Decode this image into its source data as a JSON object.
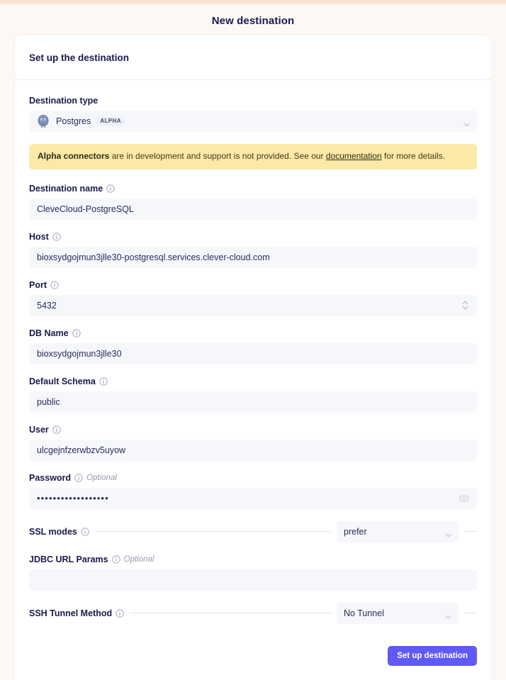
{
  "page": {
    "title": "New destination",
    "background_color": "#fdf8f4",
    "accent_color": "#6159f5"
  },
  "card": {
    "header_title": "Set up the destination"
  },
  "destination_type": {
    "label": "Destination type",
    "selected": "Postgres",
    "badge": "ALPHA",
    "icon": "postgres-elephant-icon",
    "chevron": "chevron-down-icon"
  },
  "alpha_banner": {
    "strong_text": "Alpha connectors",
    "text_before_link": " are in development and support is not provided. See our ",
    "link_text": "documentation",
    "text_after_link": " for more details.",
    "background_color": "#fbe9a8"
  },
  "fields": [
    {
      "name": "destination-name",
      "label": "Destination name",
      "value": "CleveCloud-PostgreSQL",
      "optional": "",
      "info_icon": "info-icon",
      "type": "text"
    },
    {
      "name": "host",
      "label": "Host",
      "value": "bioxsydgojmun3jlle30-postgresql.services.clever-cloud.com",
      "optional": "",
      "info_icon": "info-icon",
      "type": "text"
    },
    {
      "name": "port",
      "label": "Port",
      "value": "5432",
      "optional": "",
      "info_icon": "info-icon",
      "type": "number"
    },
    {
      "name": "db-name",
      "label": "DB Name",
      "value": "bioxsydgojmun3jlle30",
      "optional": "",
      "info_icon": "info-icon",
      "type": "text"
    },
    {
      "name": "default-schema",
      "label": "Default Schema",
      "value": "public",
      "optional": "",
      "info_icon": "info-icon",
      "type": "text"
    },
    {
      "name": "user",
      "label": "User",
      "value": "ulcgejnfzerwbzv5uyow",
      "optional": "",
      "info_icon": "info-icon",
      "type": "text"
    },
    {
      "name": "password",
      "label": "Password",
      "value": "••••••••••••••••••",
      "optional": "Optional",
      "info_icon": "info-icon",
      "type": "password"
    }
  ],
  "ssl_modes": {
    "label": "SSL modes",
    "selected": "prefer",
    "info_icon": "info-icon",
    "chevron": "chevron-down-icon"
  },
  "jdbc_url_params": {
    "label": "JDBC URL Params",
    "optional": "Optional",
    "value": "",
    "info_icon": "info-icon"
  },
  "ssh_tunnel_method": {
    "label": "SSH Tunnel Method",
    "selected": "No Tunnel",
    "info_icon": "info-icon",
    "chevron": "chevron-down-icon"
  },
  "footer": {
    "submit_label": "Set up destination"
  }
}
